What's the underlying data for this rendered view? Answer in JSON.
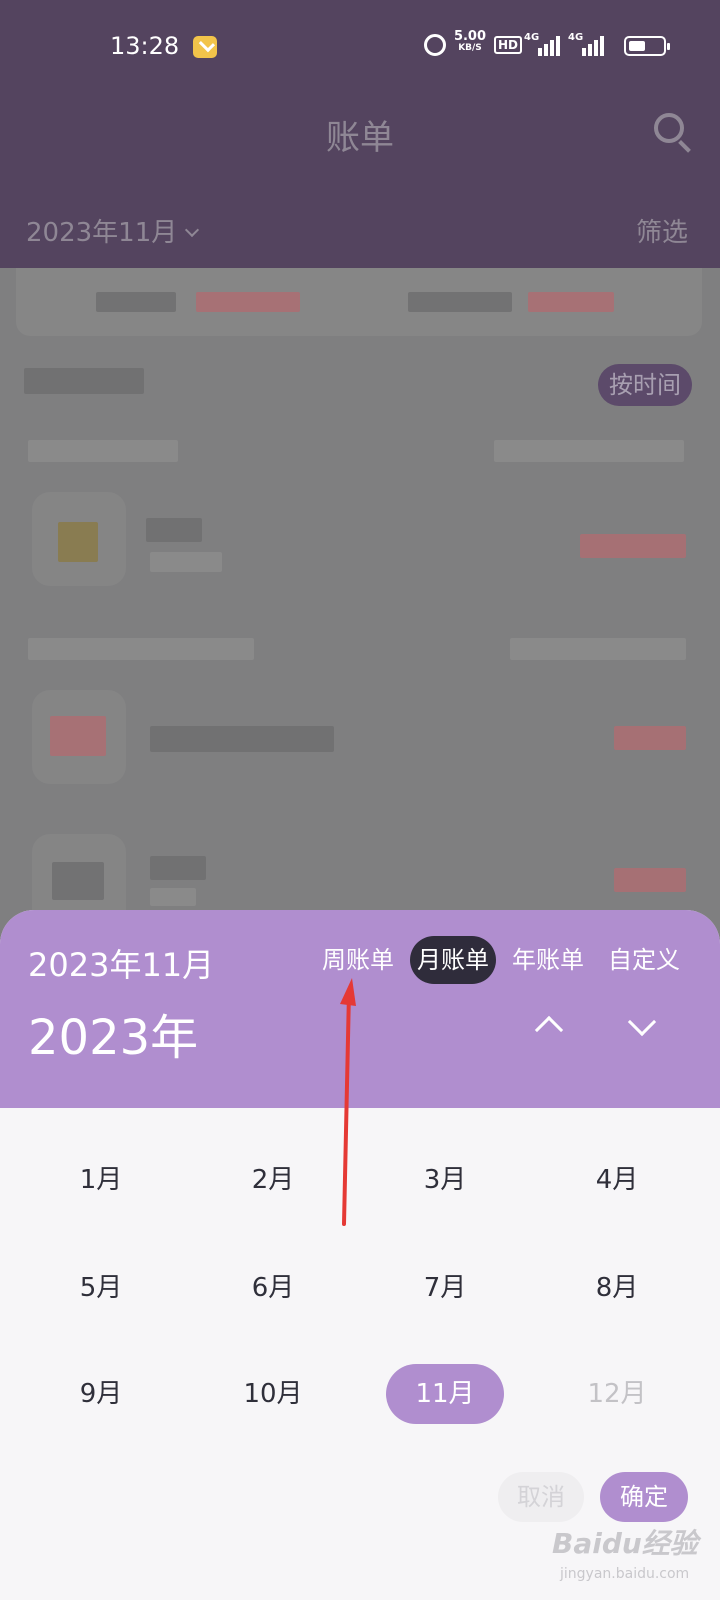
{
  "status_bar": {
    "time": "13:28",
    "net_speed": "5.00",
    "net_unit": "KB/S",
    "hd": "HD",
    "sig1": "4G",
    "sig2": "4G"
  },
  "header": {
    "title": "账单",
    "month": "2023年11月",
    "filter": "筛选"
  },
  "list": {
    "sort_chip": "按时间"
  },
  "sheet": {
    "selected_label": "2023年11月",
    "year_label": "2023年",
    "tabs": [
      "周账单",
      "月账单",
      "年账单",
      "自定义"
    ],
    "active_tab": "月账单",
    "months": [
      "1月",
      "2月",
      "3月",
      "4月",
      "5月",
      "6月",
      "7月",
      "8月",
      "9月",
      "10月",
      "11月",
      "12月"
    ],
    "selected_month": "11月",
    "cancel": "取消",
    "confirm": "确定"
  },
  "watermark": {
    "brand": "Baidu经验",
    "url": "jingyan.baidu.com"
  },
  "colors": {
    "header_bg": "#54445f",
    "accent": "#b08ecf",
    "active_tab": "#2f2c3b",
    "annotation": "#e53935"
  }
}
